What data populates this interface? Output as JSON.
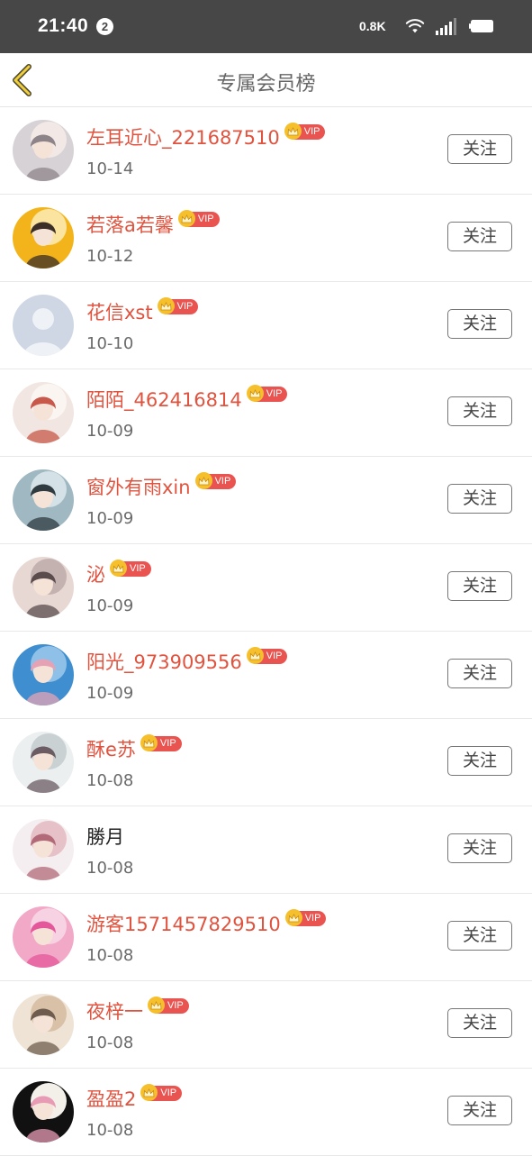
{
  "status_bar": {
    "time": "21:40",
    "notification_count": "2",
    "net_speed": "0.8K"
  },
  "header": {
    "title": "专属会员榜",
    "back_icon": "chevron-left-icon"
  },
  "colors": {
    "name_vip": "#e0533f",
    "vip_badge": "#ea5450",
    "crown": "#f6c02d",
    "status_bar": "#474747"
  },
  "members": [
    {
      "name": "左耳近心_221687510",
      "date": "10-14",
      "vip": true,
      "vip_label": "VIP",
      "follow_label": "关注"
    },
    {
      "name": "若落a若馨",
      "date": "10-12",
      "vip": true,
      "vip_label": "VIP",
      "follow_label": "关注"
    },
    {
      "name": "花信xst",
      "date": "10-10",
      "vip": true,
      "vip_label": "VIP",
      "follow_label": "关注"
    },
    {
      "name": "陌陌_462416814",
      "date": "10-09",
      "vip": true,
      "vip_label": "VIP",
      "follow_label": "关注"
    },
    {
      "name": "窗外有雨xin",
      "date": "10-09",
      "vip": true,
      "vip_label": "VIP",
      "follow_label": "关注"
    },
    {
      "name": "泌",
      "date": "10-09",
      "vip": true,
      "vip_label": "VIP",
      "follow_label": "关注"
    },
    {
      "name": "阳光_973909556",
      "date": "10-09",
      "vip": true,
      "vip_label": "VIP",
      "follow_label": "关注"
    },
    {
      "name": "酥e苏",
      "date": "10-08",
      "vip": true,
      "vip_label": "VIP",
      "follow_label": "关注"
    },
    {
      "name": "勝月",
      "date": "10-08",
      "vip": false,
      "vip_label": "",
      "follow_label": "关注"
    },
    {
      "name": "游客1571457829510",
      "date": "10-08",
      "vip": true,
      "vip_label": "VIP",
      "follow_label": "关注"
    },
    {
      "name": "夜梓一",
      "date": "10-08",
      "vip": true,
      "vip_label": "VIP",
      "follow_label": "关注"
    },
    {
      "name": "盈盈2",
      "date": "10-08",
      "vip": true,
      "vip_label": "VIP",
      "follow_label": "关注"
    }
  ]
}
